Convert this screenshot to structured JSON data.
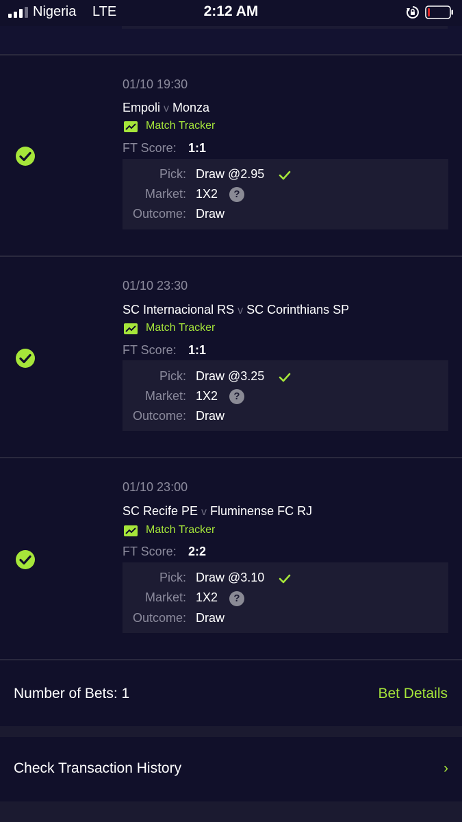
{
  "status_bar": {
    "carrier": "Nigeria",
    "network": "LTE",
    "time": "2:12 AM"
  },
  "matches": [
    {
      "date": "01/10 19:30",
      "home": "Empoli",
      "vs": "v",
      "away": "Monza",
      "tracker_label": "Match Tracker",
      "ft_label": "FT Score:",
      "ft_score": "1:1",
      "pick_label": "Pick:",
      "pick": "Draw @2.95",
      "market_label": "Market:",
      "market": "1X2",
      "outcome_label": "Outcome:",
      "outcome": "Draw"
    },
    {
      "date": "01/10 23:30",
      "home": "SC Internacional RS",
      "vs": "v",
      "away": "SC Corinthians SP",
      "tracker_label": "Match Tracker",
      "ft_label": "FT Score:",
      "ft_score": "1:1",
      "pick_label": "Pick:",
      "pick": "Draw @3.25",
      "market_label": "Market:",
      "market": "1X2",
      "outcome_label": "Outcome:",
      "outcome": "Draw"
    },
    {
      "date": "01/10 23:00",
      "home": "SC Recife PE",
      "vs": "v",
      "away": "Fluminense FC RJ",
      "tracker_label": "Match Tracker",
      "ft_label": "FT Score:",
      "ft_score": "2:2",
      "pick_label": "Pick:",
      "pick": "Draw @3.10",
      "market_label": "Market:",
      "market": "1X2",
      "outcome_label": "Outcome:",
      "outcome": "Draw"
    }
  ],
  "summary": {
    "number_of_bets": "Number of Bets: 1",
    "bet_details": "Bet Details"
  },
  "history": {
    "label": "Check Transaction History",
    "chevron": "›"
  },
  "icons": {
    "status_check": "check-circle-icon",
    "tracker": "chart-trend-icon",
    "pick_tick": "check-mark-icon",
    "help": "question-icon"
  },
  "colors": {
    "accent": "#a6e63a",
    "background": "#11102a",
    "panel": "#1d1c33"
  }
}
